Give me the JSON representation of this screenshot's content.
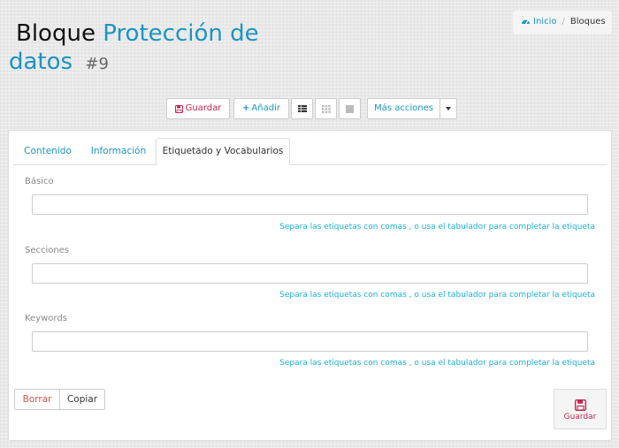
{
  "header": {
    "title_part1": "Bloque",
    "title_part2": "Protección de datos",
    "record_number": "#9"
  },
  "breadcrumb": {
    "home_label": "Inicio",
    "current_label": "Bloques"
  },
  "toolbar": {
    "save_label": "Guardar",
    "add_label": "Añadir",
    "more_actions_label": "Más acciones"
  },
  "tabs": [
    {
      "label": "Contenido"
    },
    {
      "label": "Información"
    },
    {
      "label": "Etiquetado y Vocabularios"
    }
  ],
  "fields": [
    {
      "label": "Básico",
      "value": "",
      "help": "Separa las etiquetas con comas , o usa el tabulador para completar la etiqueta"
    },
    {
      "label": "Secciones",
      "value": "",
      "help": "Separa las etiquetas con comas , o usa el tabulador para completar la etiqueta"
    },
    {
      "label": "Keywords",
      "value": "",
      "help": "Separa las etiquetas con comas , o usa el tabulador para completar la etiqueta"
    }
  ],
  "footer": {
    "delete_label": "Borrar",
    "copy_label": "Copiar",
    "save_label": "Guardar"
  },
  "colors": {
    "accent": "#1c94c4",
    "danger": "#d9534f",
    "save": "#c7254e",
    "help": "#1ab1d6"
  }
}
